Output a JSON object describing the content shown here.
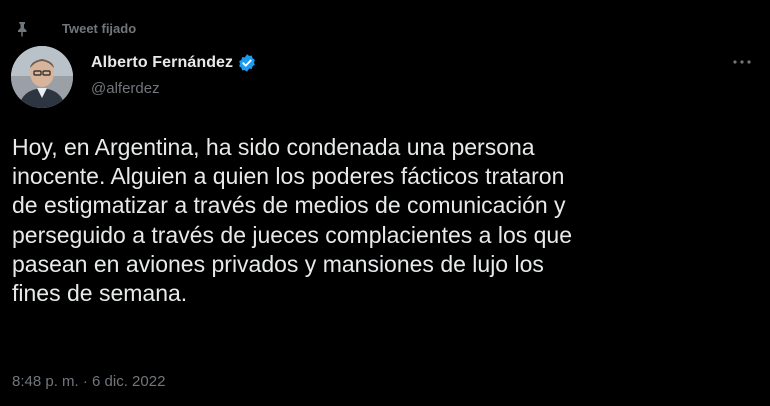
{
  "pinned": {
    "label": "Tweet fijado",
    "icon": "pin-icon"
  },
  "author": {
    "display_name": "Alberto Fernández",
    "handle": "@alferdez",
    "verified": true,
    "verified_color": "#1d9bf0"
  },
  "tweet": {
    "text": "Hoy, en Argentina, ha sido condenada una persona\ninocente. Alguien a quien los poderes fácticos trataron\nde estigmatizar a través de medios de comunicación y\nperseguido a través de jueces complacientes a los que\npasean en aviones privados y mansiones de lujo los\nfines de semana.",
    "timestamp": "8:48 p. m. · 6 dic. 2022"
  },
  "menu": {
    "icon": "more-options-icon"
  },
  "colors": {
    "background": "#000000",
    "primary_text": "#e7e9ea",
    "secondary_text": "#71767b"
  }
}
